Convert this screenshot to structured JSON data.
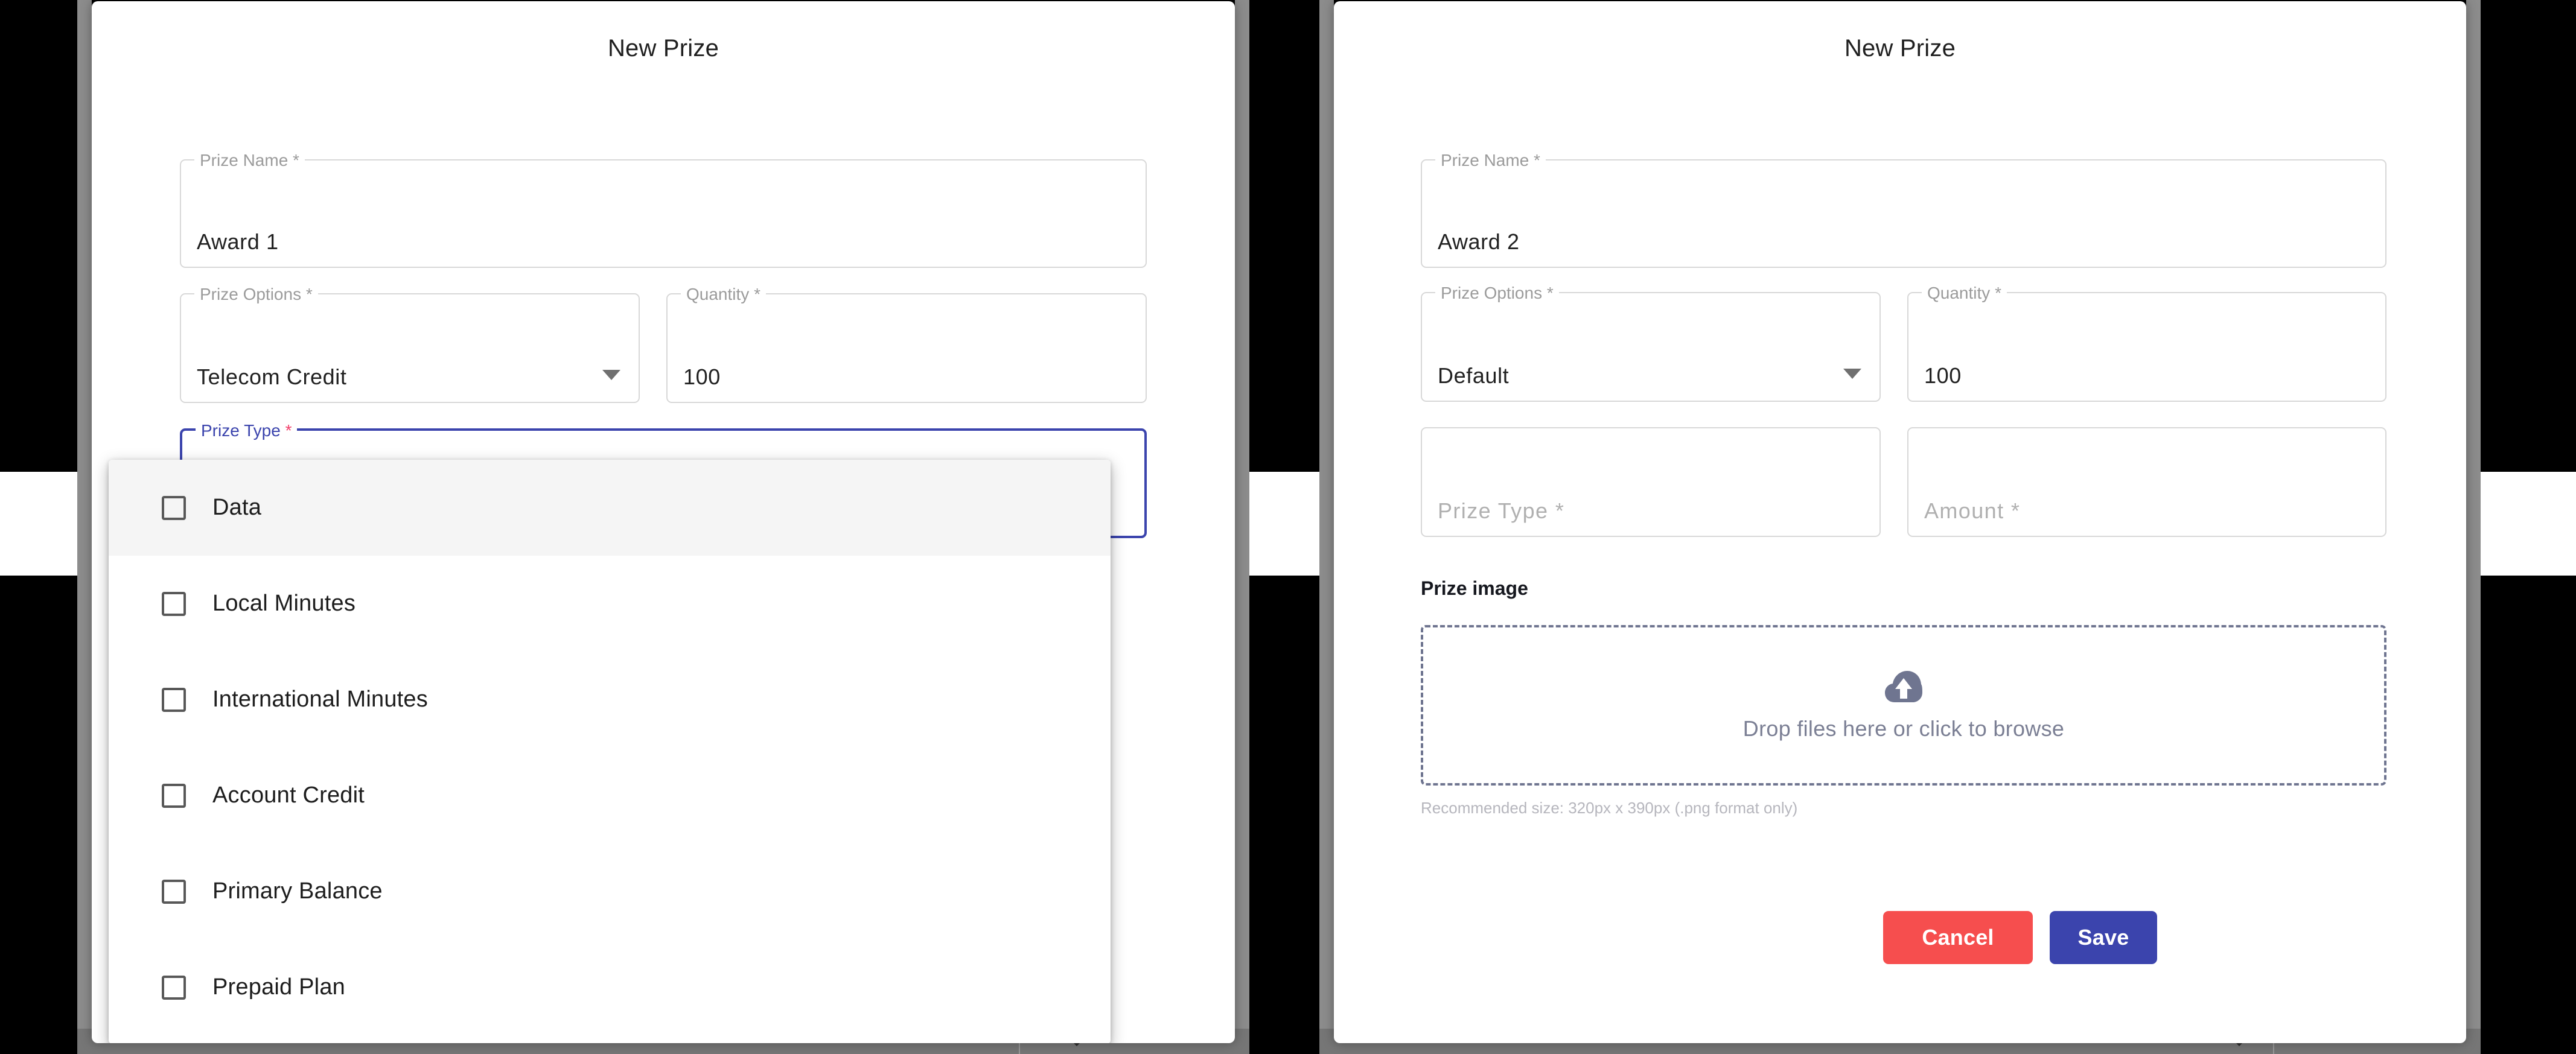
{
  "theme": {
    "accent_blue": "#3b44ad",
    "danger_red": "#f64e4e",
    "required_star": "#f2416b",
    "placeholder_grey": "#b0b0b0",
    "label_grey": "#9b9b9b",
    "dropzone_border": "#6f7590",
    "help_icon_bg": "#80859b",
    "page_background": "#000000",
    "gutter_grey": "#8c8c8c"
  },
  "left_panel": {
    "title": "New Prize",
    "fields": {
      "prize_name": {
        "label": "Prize Name",
        "required_mark": "*",
        "value": "Award 1"
      },
      "prize_options": {
        "label": "Prize Options",
        "required_mark": "*",
        "value": "Telecom Credit",
        "icon": "chevron-down-icon"
      },
      "quantity": {
        "label": "Quantity",
        "required_mark": "*",
        "value": "100"
      },
      "prize_type": {
        "label": "Prize Type",
        "required_mark": "*",
        "value": "",
        "state": "focused-open"
      }
    },
    "dropdown": {
      "open": true,
      "items": [
        {
          "label": "Data",
          "checked": false,
          "highlighted": true
        },
        {
          "label": "Local Minutes",
          "checked": false,
          "highlighted": false
        },
        {
          "label": "International Minutes",
          "checked": false,
          "highlighted": false
        },
        {
          "label": "Account Credit",
          "checked": false,
          "highlighted": false
        },
        {
          "label": "Primary Balance",
          "checked": false,
          "highlighted": false
        },
        {
          "label": "Prepaid Plan",
          "checked": false,
          "highlighted": false
        }
      ]
    },
    "scroll_chevron": "chevron-down-icon"
  },
  "right_panel": {
    "title": "New Prize",
    "fields": {
      "prize_name": {
        "label": "Prize Name",
        "required_mark": "*",
        "value": "Award 2"
      },
      "prize_options": {
        "label": "Prize Options",
        "required_mark": "*",
        "value": "Default",
        "icon": "chevron-down-icon"
      },
      "quantity": {
        "label": "Quantity",
        "required_mark": "*",
        "value": "100"
      },
      "prize_type": {
        "label": "",
        "required_mark": "",
        "placeholder": "Prize Type *"
      },
      "amount": {
        "label": "",
        "required_mark": "",
        "placeholder": "Amount *"
      }
    },
    "prize_image": {
      "section_label": "Prize image",
      "help_icon": "question-mark-icon",
      "dropzone_icon": "cloud-upload-icon",
      "dropzone_text": "Drop files here or click to browse",
      "hint": "Recommended size: 320px x 390px (.png format only)"
    },
    "actions": {
      "cancel_label": "Cancel",
      "save_label": "Save"
    },
    "scroll_chevron": "chevron-down-icon"
  }
}
